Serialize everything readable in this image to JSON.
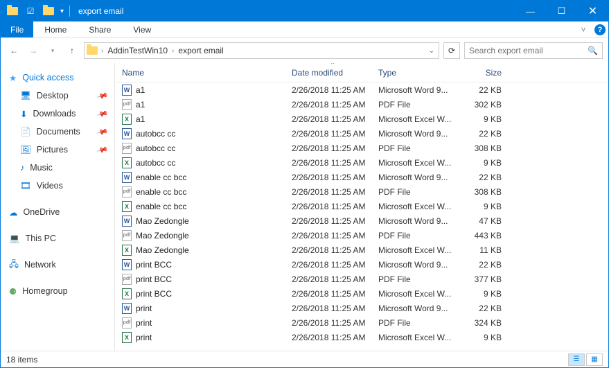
{
  "window": {
    "title": "export email"
  },
  "tabs": {
    "file": "File",
    "home": "Home",
    "share": "Share",
    "view": "View"
  },
  "address": {
    "crumb1": "AddinTestWin10",
    "crumb2": "export email"
  },
  "search": {
    "placeholder": "Search export email"
  },
  "columns": {
    "name": "Name",
    "date": "Date modified",
    "type": "Type",
    "size": "Size"
  },
  "sidebar": {
    "quick": "Quick access",
    "desktop": "Desktop",
    "downloads": "Downloads",
    "documents": "Documents",
    "pictures": "Pictures",
    "music": "Music",
    "videos": "Videos",
    "onedrive": "OneDrive",
    "thispc": "This PC",
    "network": "Network",
    "homegroup": "Homegroup"
  },
  "files": [
    {
      "icon": "word",
      "name": "a1",
      "date": "2/26/2018 11:25 AM",
      "type": "Microsoft Word 9...",
      "size": "22 KB"
    },
    {
      "icon": "pdf",
      "name": "a1",
      "date": "2/26/2018 11:25 AM",
      "type": "PDF File",
      "size": "302 KB"
    },
    {
      "icon": "excel",
      "name": "a1",
      "date": "2/26/2018 11:25 AM",
      "type": "Microsoft Excel W...",
      "size": "9 KB"
    },
    {
      "icon": "word",
      "name": "autobcc cc",
      "date": "2/26/2018 11:25 AM",
      "type": "Microsoft Word 9...",
      "size": "22 KB"
    },
    {
      "icon": "pdf",
      "name": "autobcc cc",
      "date": "2/26/2018 11:25 AM",
      "type": "PDF File",
      "size": "308 KB"
    },
    {
      "icon": "excel",
      "name": "autobcc cc",
      "date": "2/26/2018 11:25 AM",
      "type": "Microsoft Excel W...",
      "size": "9 KB"
    },
    {
      "icon": "word",
      "name": "enable cc bcc",
      "date": "2/26/2018 11:25 AM",
      "type": "Microsoft Word 9...",
      "size": "22 KB"
    },
    {
      "icon": "pdf",
      "name": "enable cc bcc",
      "date": "2/26/2018 11:25 AM",
      "type": "PDF File",
      "size": "308 KB"
    },
    {
      "icon": "excel",
      "name": "enable cc bcc",
      "date": "2/26/2018 11:25 AM",
      "type": "Microsoft Excel W...",
      "size": "9 KB"
    },
    {
      "icon": "word",
      "name": "Mao Zedongle",
      "date": "2/26/2018 11:25 AM",
      "type": "Microsoft Word 9...",
      "size": "47 KB"
    },
    {
      "icon": "pdf",
      "name": "Mao Zedongle",
      "date": "2/26/2018 11:25 AM",
      "type": "PDF File",
      "size": "443 KB"
    },
    {
      "icon": "excel",
      "name": "Mao Zedongle",
      "date": "2/26/2018 11:25 AM",
      "type": "Microsoft Excel W...",
      "size": "11 KB"
    },
    {
      "icon": "word",
      "name": "print BCC",
      "date": "2/26/2018 11:25 AM",
      "type": "Microsoft Word 9...",
      "size": "22 KB"
    },
    {
      "icon": "pdf",
      "name": "print BCC",
      "date": "2/26/2018 11:25 AM",
      "type": "PDF File",
      "size": "377 KB"
    },
    {
      "icon": "excel",
      "name": "print BCC",
      "date": "2/26/2018 11:25 AM",
      "type": "Microsoft Excel W...",
      "size": "9 KB"
    },
    {
      "icon": "word",
      "name": "print",
      "date": "2/26/2018 11:25 AM",
      "type": "Microsoft Word 9...",
      "size": "22 KB"
    },
    {
      "icon": "pdf",
      "name": "print",
      "date": "2/26/2018 11:25 AM",
      "type": "PDF File",
      "size": "324 KB"
    },
    {
      "icon": "excel",
      "name": "print",
      "date": "2/26/2018 11:25 AM",
      "type": "Microsoft Excel W...",
      "size": "9 KB"
    }
  ],
  "status": {
    "count": "18 items"
  }
}
